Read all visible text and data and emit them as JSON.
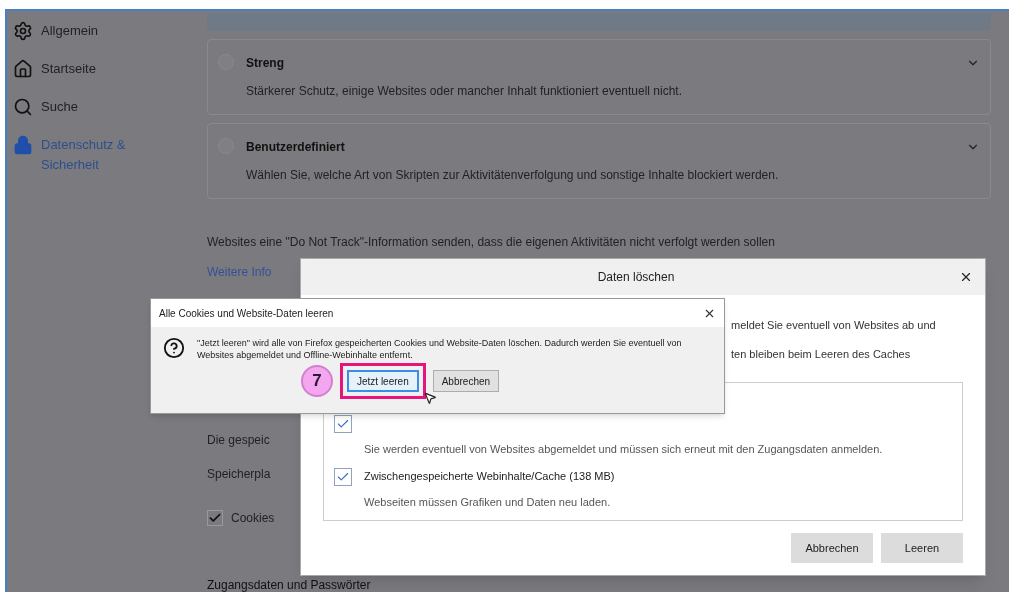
{
  "sidebar": {
    "items": [
      {
        "kind": "gear",
        "label": "Allgemein",
        "selected": false
      },
      {
        "kind": "home",
        "label": "Startseite",
        "selected": false
      },
      {
        "kind": "search",
        "label": "Suche",
        "selected": false
      },
      {
        "kind": "lock",
        "label": "Datenschutz & Sicherheit",
        "selected": true
      }
    ]
  },
  "options": [
    {
      "title": "Streng",
      "description": "Stärkerer Schutz, einige Websites oder mancher Inhalt funktioniert eventuell nicht.",
      "selected": false
    },
    {
      "title": "Benutzerdefiniert",
      "description": "Wählen Sie, welche Art von Skripten zur Aktivitätenverfolgung und sonstige Inhalte blockiert werden.",
      "selected": false
    }
  ],
  "dnt_text": "Websites eine \"Do Not Track\"-Information senden, dass die eigenen Aktivitäten nicht verfolgt werden sollen",
  "dnt_link": "Weitere Info",
  "storage_lines": [
    "Die gespeic",
    "Speicherpla"
  ],
  "cookies_checkbox": {
    "label": "Cookies",
    "checked": true
  },
  "section_heading": "Zugangsdaten und Passwörter",
  "clear_dialog": {
    "title": "Daten löschen",
    "lines": [
      "meldet Sie eventuell von Websites ab und",
      "ten bleiben beim Leeren des Caches"
    ],
    "items": [
      {
        "checked": true,
        "description": "Sie werden eventuell von Websites abgemeldet und müssen sich erneut mit den Zugangsdaten anmelden."
      },
      {
        "checked": true,
        "label": "Zwischengespeicherte Webinhalte/Cache (138 MB)",
        "description": "Webseiten müssen Grafiken und Daten neu laden."
      }
    ],
    "buttons": [
      "Abbrechen",
      "Leeren"
    ]
  },
  "confirm_dialog": {
    "title": "Alle Cookies und Website-Daten leeren",
    "message": "\"Jetzt leeren\" wird alle von Firefox gespeicherten Cookies und Website-Daten löschen. Dadurch werden Sie eventuell von Websites abgemeldet und Offline-Webinhalte entfernt.",
    "buttons": [
      {
        "label": "Jetzt leeren",
        "selected": true
      },
      {
        "label": "Abbrechen",
        "selected": false
      }
    ]
  },
  "step_marker": "7"
}
